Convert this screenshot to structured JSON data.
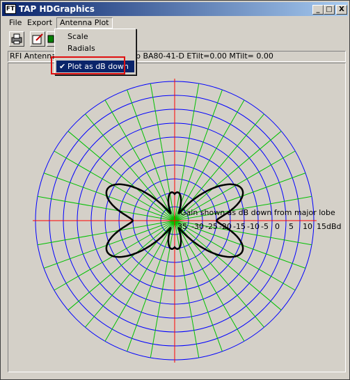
{
  "window": {
    "title": "TAP HDGraphics",
    "app_icon_text": "FT",
    "minimize_label": "_",
    "maximize_label": "□",
    "close_label": "X"
  },
  "menubar": {
    "items": [
      {
        "label": "File"
      },
      {
        "label": "Export"
      },
      {
        "label": "Antenna Plot"
      }
    ]
  },
  "dropdown": {
    "items": [
      {
        "label": "Scale",
        "checked": false
      },
      {
        "label": "Radials",
        "checked": false
      },
      {
        "label": "Plot as dB down",
        "checked": true
      }
    ],
    "check_glyph": "✔"
  },
  "toolbar": {
    "buttons": [
      {
        "icon": "printer-icon"
      },
      {
        "icon": "edit-icon"
      },
      {
        "icon": "export-icon"
      }
    ]
  },
  "status": {
    "left_text": "RFI Antennas",
    "right_text": "up BA80-41-D ETilt=0.00 MTilt= 0.00"
  },
  "plot": {
    "annotation": "Gain shown as dB down from major lobe",
    "scale_labels": [
      "35",
      "30",
      "25",
      "20",
      "15",
      "10",
      "5",
      "0",
      "5",
      "10",
      "15dBd"
    ],
    "scale_prefix": "-",
    "colors": {
      "rings": "#0000ff",
      "radials": "#00c000",
      "axes": "#ff0000",
      "pattern": "#000000"
    }
  }
}
